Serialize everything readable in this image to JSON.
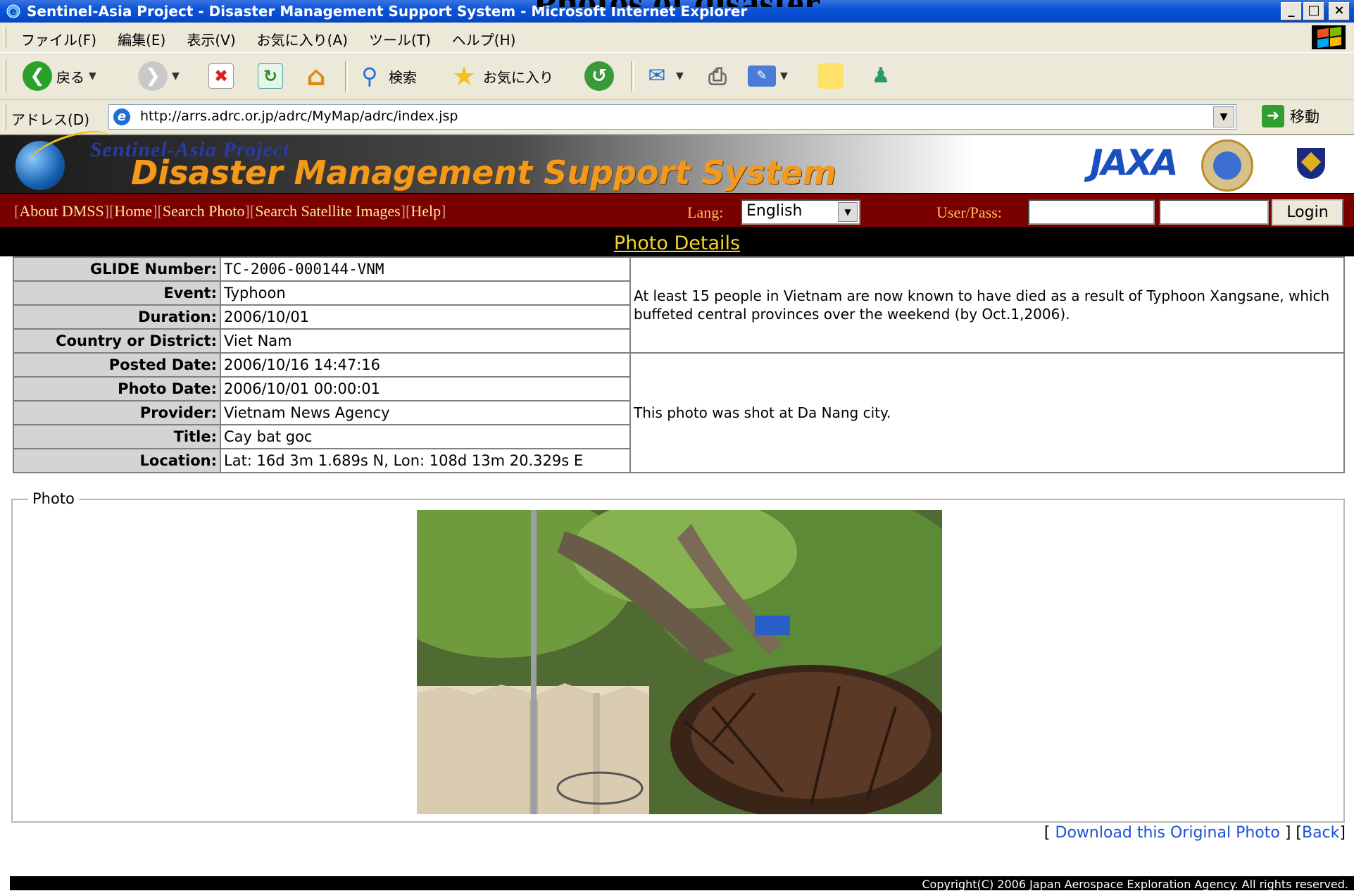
{
  "slide": {
    "title": "Photos of disaster"
  },
  "window": {
    "title": "Sentinel-Asia Project - Disaster Management Support System - Microsoft Internet Explorer",
    "controls": [
      "_",
      "□",
      "×"
    ]
  },
  "menu": {
    "items": [
      "ファイル(F)",
      "編集(E)",
      "表示(V)",
      "お気に入り(A)",
      "ツール(T)",
      "ヘルプ(H)"
    ]
  },
  "toolbar": {
    "back_label": "戻る",
    "search_label": "検索",
    "favorites_label": "お気に入り"
  },
  "address": {
    "label": "アドレス(D)",
    "url": "http://arrs.adrc.or.jp/adrc/MyMap/adrc/index.jsp",
    "go_label": "移動"
  },
  "site": {
    "subtitle": "Sentinel-Asia Project",
    "title": "Disaster Management Support System",
    "logo_text": "JAXA"
  },
  "nav": {
    "links": [
      "About DMSS",
      "Home",
      "Search Photo",
      "Search Satellite Images",
      "Help"
    ],
    "lang_label": "Lang:",
    "lang_value": "English",
    "user_label": "User/Pass:",
    "login_label": "Login"
  },
  "section": {
    "title": "Photo Details"
  },
  "details": {
    "rows": [
      {
        "label": "GLIDE Number:",
        "value": "TC-2006-000144-VNM"
      },
      {
        "label": "Event:",
        "value": "Typhoon"
      },
      {
        "label": "Duration:",
        "value": "2006/10/01"
      },
      {
        "label": "Country or District:",
        "value": "Viet Nam"
      },
      {
        "label": "Posted Date:",
        "value": "2006/10/16 14:47:16"
      },
      {
        "label": "Photo Date:",
        "value": "2006/10/01 00:00:01"
      },
      {
        "label": "Provider:",
        "value": "Vietnam News Agency"
      },
      {
        "label": "Title:",
        "value": "Cay bat goc"
      },
      {
        "label": "Location:",
        "value": "Lat: 16d 3m 1.689s N, Lon: 108d 13m 20.329s E"
      }
    ],
    "event_description": "At least 15 people in Vietnam are now known to have died as a result of Typhoon Xangsane, which buffeted central provinces over the weekend (by Oct.1,2006).",
    "photo_description": "This photo was shot at Da Nang city."
  },
  "photo": {
    "legend": "Photo"
  },
  "links": {
    "download_label": "Download this Original Photo",
    "back_label": "Back"
  },
  "footer": {
    "copyright": "Copyright(C) 2006 Japan Aerospace Exploration Agency. All rights reserved."
  },
  "colors": {
    "titlebar": "#0a54d8",
    "nav_background": "#7a0000",
    "section_title": "#f2d430",
    "site_title": "#f39a1c",
    "link": "#1a4fd8"
  }
}
